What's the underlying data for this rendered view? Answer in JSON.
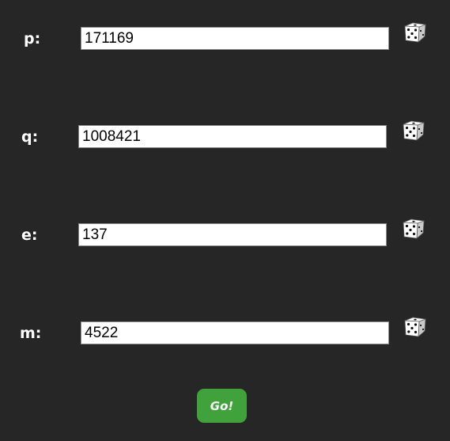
{
  "fields": [
    {
      "label": "p:",
      "value": "171169",
      "icon": "dice-icon"
    },
    {
      "label": "q:",
      "value": "1008421",
      "icon": "dice-icon"
    },
    {
      "label": "e:",
      "value": "137",
      "icon": "dice-icon"
    },
    {
      "label": "m:",
      "value": "4522",
      "icon": "dice-icon"
    }
  ],
  "go_label": "Go!",
  "colors": {
    "background": "#262626",
    "button": "#3fa23a",
    "text": "#ffffff"
  }
}
